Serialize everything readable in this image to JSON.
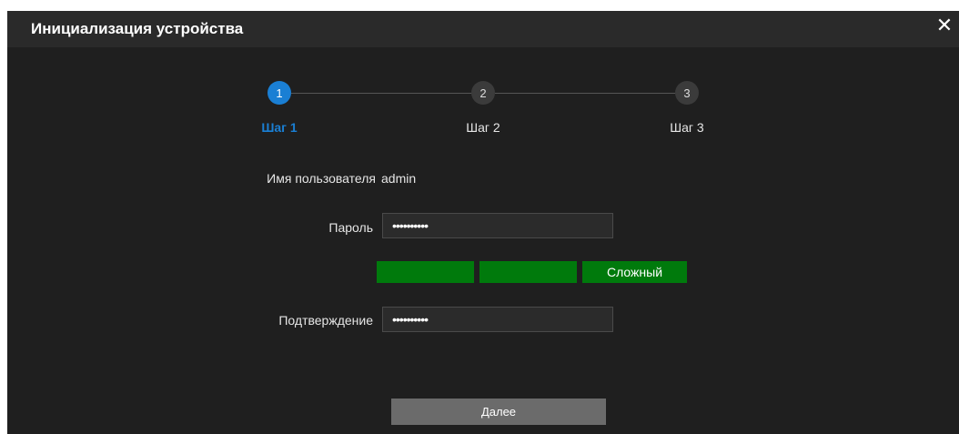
{
  "dialog": {
    "title": "Инициализация устройства",
    "close_label": "✕"
  },
  "steps": [
    {
      "number": "1",
      "label": "Шаг 1",
      "active": true
    },
    {
      "number": "2",
      "label": "Шаг 2",
      "active": false
    },
    {
      "number": "3",
      "label": "Шаг 3",
      "active": false
    }
  ],
  "form": {
    "username_label": "Имя пользователя",
    "username_value": "admin",
    "password_label": "Пароль",
    "password_value": "••••••••••",
    "strength_label": "Сложный",
    "confirm_label": "Подтверждение",
    "confirm_value": "••••••••••"
  },
  "actions": {
    "next_label": "Далее"
  },
  "colors": {
    "accent": "#1a7fd4",
    "strength": "#007a0c",
    "background": "#1f1f1f"
  }
}
